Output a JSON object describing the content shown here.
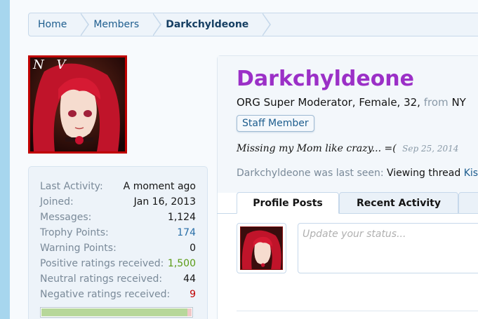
{
  "breadcrumb": {
    "items": [
      {
        "label": "Home"
      },
      {
        "label": "Members"
      },
      {
        "label": "Darkchyldeone"
      }
    ]
  },
  "avatar": {
    "overlay_text": "N V"
  },
  "profile": {
    "username": "Darkchyldeone",
    "title_main": "ORG Super Moderator, Female, 32,",
    "title_from": "from",
    "title_location": "NY",
    "badge": "Staff Member",
    "status_text": "Missing my Mom like crazy... =(",
    "status_date": "Sep 25, 2014",
    "last_seen_prefix": "Darkchyldeone was last seen:",
    "last_seen_action": "Viewing thread",
    "last_seen_link": "Kiss, I",
    "status_placeholder": "Update your status..."
  },
  "tabs": [
    {
      "label": "Profile Posts"
    },
    {
      "label": "Recent Activity"
    }
  ],
  "stats": {
    "rows": [
      {
        "label": "Last Activity:",
        "value": "A moment ago"
      },
      {
        "label": "Joined:",
        "value": "Jan 16, 2013"
      },
      {
        "label": "Messages:",
        "value": "1,124"
      },
      {
        "label": "Trophy Points:",
        "value": "174"
      },
      {
        "label": "Warning Points:",
        "value": "0"
      },
      {
        "label": "Positive ratings received:",
        "value": "1,500"
      },
      {
        "label": "Neutral ratings received:",
        "value": "44"
      },
      {
        "label": "Negative ratings received:",
        "value": "9"
      }
    ],
    "rating_bar_positive_fraction": 0.97
  },
  "colors": {
    "username": "#9b30c7",
    "link": "#1d5d8e",
    "positive": "#5a9b14",
    "negative": "#c00000",
    "trophy": "#2a6fa8"
  }
}
